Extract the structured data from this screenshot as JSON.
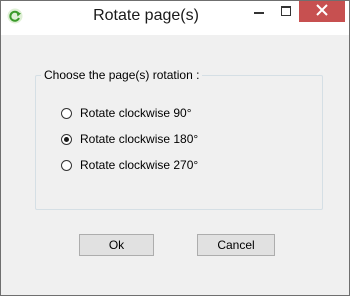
{
  "window": {
    "title": "Rotate page(s)",
    "icon": "green-rotate-arrow-icon"
  },
  "caption": {
    "minimize_icon": "minimize-icon",
    "maximize_icon": "maximize-icon",
    "close_icon": "close-icon"
  },
  "group": {
    "label": "Choose the page(s) rotation :",
    "options": [
      {
        "label": "Rotate clockwise 90°",
        "selected": false
      },
      {
        "label": "Rotate clockwise 180°",
        "selected": true
      },
      {
        "label": "Rotate clockwise 270°",
        "selected": false
      }
    ]
  },
  "buttons": {
    "ok": "Ok",
    "cancel": "Cancel"
  },
  "colors": {
    "close": "#c75050",
    "client": "#f0f0f0",
    "icon_green": "#3a9a2a"
  }
}
